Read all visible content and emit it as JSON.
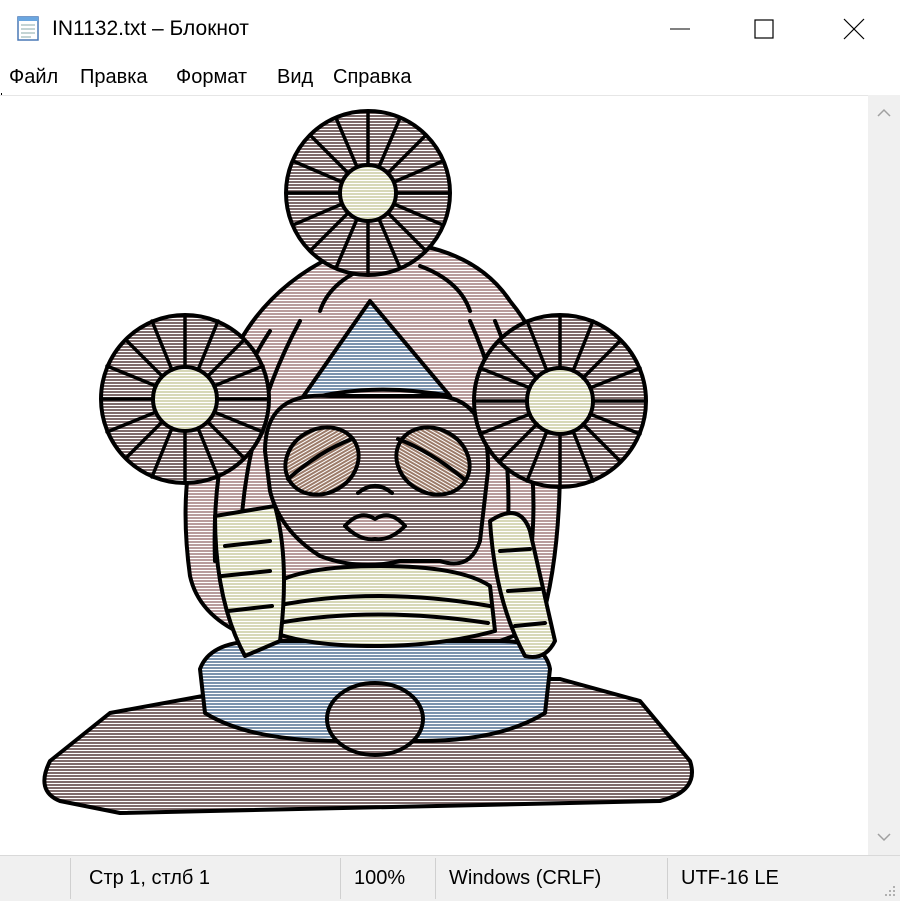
{
  "window": {
    "title": "IN1132.txt – Блокнот"
  },
  "menu": {
    "items": [
      "Файл",
      "Правка",
      "Формат",
      "Вид",
      "Справка"
    ]
  },
  "statusbar": {
    "position": "Стр 1, стлб 1",
    "zoom": "100%",
    "line_endings": "Windows (CRLF)",
    "encoding": "UTF-16 LE"
  },
  "icons": {
    "app": "notepad-icon",
    "minimize": "minimize-icon",
    "maximize": "maximize-icon",
    "close": "close-icon",
    "scroll_up": "scroll-up-arrow-icon",
    "scroll_down": "scroll-down-arrow-icon",
    "grip": "resize-grip-icon"
  },
  "colors": {
    "stripe_brown": "#7f6b6b",
    "stripe_pink": "#b89c9c",
    "stripe_blue": "#7c93ad",
    "stripe_cream": "#d7d8b8",
    "outline": "#000000"
  }
}
